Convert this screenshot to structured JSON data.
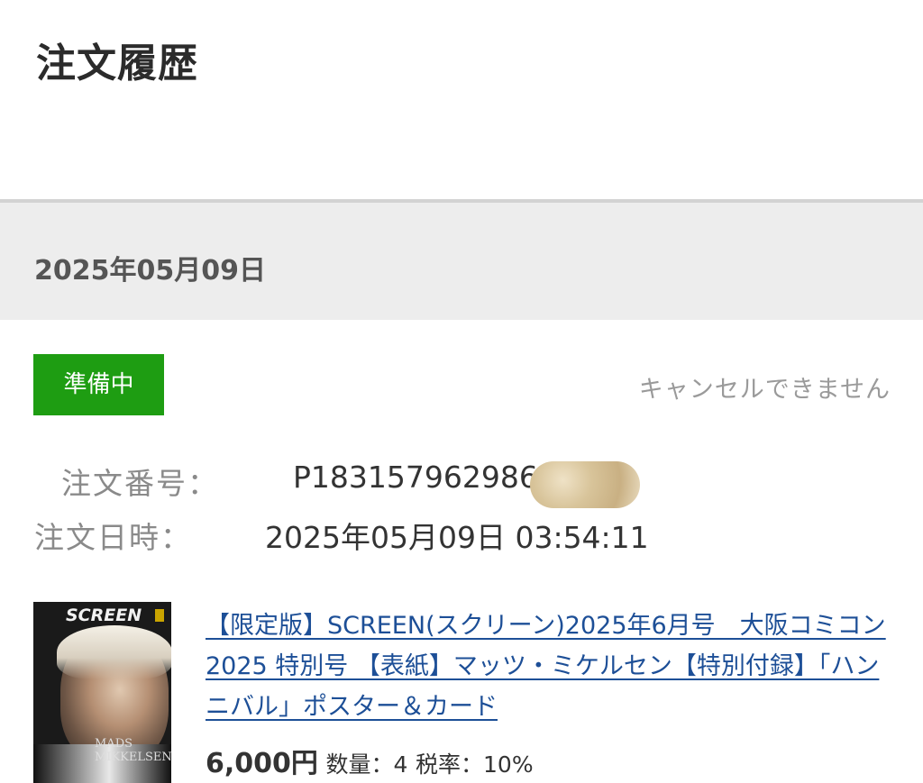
{
  "header": {
    "title": "注文履歴"
  },
  "order": {
    "date_heading": "2025年05月09日",
    "status": "準備中",
    "cancel_note": "キャンセルできません",
    "number_label": "注文番号：",
    "number_value": "P18315796298689",
    "datetime_label": "注文日時：",
    "datetime_value": "2025年05月09日 03:54:11"
  },
  "item": {
    "cover_masthead": "SCREEN",
    "cover_name": "MADS MIKKELSEN",
    "title": "【限定版】SCREEN(スクリーン)2025年6月号　大阪コミコン2025 特別号 【表紙】マッツ・ミケルセン【特別付録】「ハンニバル」ポスター＆カード",
    "price": "6,000円",
    "quantity_label": "数量：",
    "quantity_value": "4",
    "tax_label": "税率：",
    "tax_value": "10%"
  },
  "colors": {
    "status_green": "#1e9d12",
    "link_blue": "#1d4f97",
    "band_gray": "#ededed"
  }
}
